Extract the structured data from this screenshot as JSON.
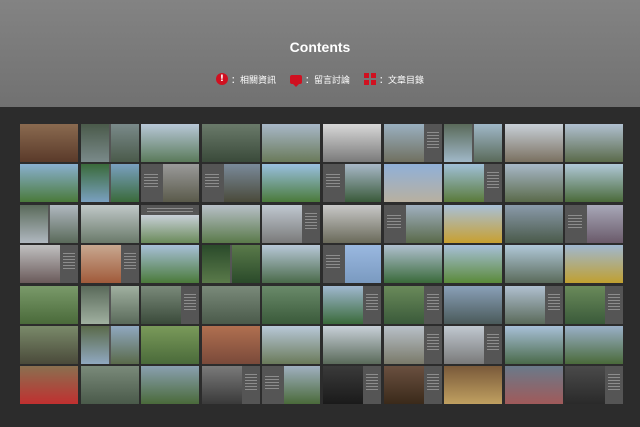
{
  "page": {
    "title": "Contents",
    "links": [
      {
        "icon": "info-icon",
        "label": "：相關資訊"
      },
      {
        "icon": "comment-icon",
        "label": "：留言討論"
      },
      {
        "icon": "grid-icon",
        "label": "：文章目錄"
      }
    ]
  },
  "colors": {
    "header": "#7a7a7a",
    "background": "#2c2c2c",
    "accent": "#d01020"
  },
  "thumbnails": [
    {
      "layout": "full",
      "colors": [
        "#8a6a50",
        "#5a3a2a"
      ]
    },
    {
      "layout": "split",
      "colors": [
        "#7a8a8a",
        "#4a5a4a"
      ]
    },
    {
      "layout": "full",
      "colors": [
        "#b8c8d8",
        "#5a7a5a"
      ]
    },
    {
      "layout": "full",
      "colors": [
        "#6a7a6a",
        "#3a4a3a"
      ]
    },
    {
      "layout": "full",
      "colors": [
        "#a8b8c8",
        "#6a7a5a"
      ]
    },
    {
      "layout": "full",
      "colors": [
        "#d8d8d8",
        "#7a7a7a"
      ]
    },
    {
      "layout": "text-right",
      "colors": [
        "#9ab0c0",
        "#707060"
      ]
    },
    {
      "layout": "split",
      "colors": [
        "#a0b8c8",
        "#5a6a5a"
      ]
    },
    {
      "layout": "full",
      "colors": [
        "#c8d0d8",
        "#7a7060"
      ]
    },
    {
      "layout": "full",
      "colors": [
        "#b0c0d0",
        "#5a6a4a"
      ]
    },
    {
      "layout": "full",
      "colors": [
        "#8ab0d0",
        "#4a7a3a"
      ]
    },
    {
      "layout": "split",
      "colors": [
        "#7aa0c0",
        "#3a6a3a"
      ]
    },
    {
      "layout": "text-left",
      "colors": [
        "#9a9a9a",
        "#5a5a4a"
      ]
    },
    {
      "layout": "text-left",
      "colors": [
        "#7a8a9a",
        "#4a4a3a"
      ]
    },
    {
      "layout": "full",
      "colors": [
        "#9ac0e0",
        "#4a7a3a"
      ]
    },
    {
      "layout": "text-left",
      "colors": [
        "#a8b8c8",
        "#3a5a3a"
      ]
    },
    {
      "layout": "full",
      "colors": [
        "#90b0d8",
        "#b8b0a0"
      ]
    },
    {
      "layout": "text-right",
      "colors": [
        "#a0c0d8",
        "#5a7a3a"
      ]
    },
    {
      "layout": "full",
      "colors": [
        "#a8b8c8",
        "#5a6a4a"
      ]
    },
    {
      "layout": "full",
      "colors": [
        "#b0c8d8",
        "#4a6a3a"
      ]
    },
    {
      "layout": "split",
      "colors": [
        "#b0b8c0",
        "#5a6a5a"
      ]
    },
    {
      "layout": "full",
      "colors": [
        "#c0c8c8",
        "#6a7a6a"
      ]
    },
    {
      "layout": "text-top",
      "colors": [
        "#c8d0d8",
        "#6a8a5a"
      ]
    },
    {
      "layout": "full",
      "colors": [
        "#b8c0c8",
        "#5a7a4a"
      ]
    },
    {
      "layout": "text-right",
      "colors": [
        "#c0c8d0",
        "#7a7a7a"
      ]
    },
    {
      "layout": "full",
      "colors": [
        "#c8c8c8",
        "#6a6a5a"
      ]
    },
    {
      "layout": "text-left",
      "colors": [
        "#a0b0c0",
        "#5a6a4a"
      ]
    },
    {
      "layout": "full",
      "colors": [
        "#a8c0d8",
        "#c8a030"
      ]
    },
    {
      "layout": "full",
      "colors": [
        "#8a9aaa",
        "#4a5a4a"
      ]
    },
    {
      "layout": "text-left",
      "colors": [
        "#a8a8b8",
        "#6a5a6a"
      ]
    },
    {
      "layout": "text-right",
      "colors": [
        "#c0c0c0",
        "#6a5a5a"
      ]
    },
    {
      "layout": "text-right",
      "colors": [
        "#c8a890",
        "#a05a3a"
      ]
    },
    {
      "layout": "full",
      "colors": [
        "#a8c0d8",
        "#4a7a3a"
      ]
    },
    {
      "layout": "split",
      "colors": [
        "#5a7a4a",
        "#2a4a2a"
      ]
    },
    {
      "layout": "full",
      "colors": [
        "#b8c8d8",
        "#4a6a4a"
      ]
    },
    {
      "layout": "text-left",
      "colors": [
        "#9ab8e0",
        "#7a9ac0"
      ]
    },
    {
      "layout": "full",
      "colors": [
        "#b0c0d0",
        "#3a6a3a"
      ]
    },
    {
      "layout": "full",
      "colors": [
        "#a8c0d8",
        "#5a8a3a"
      ]
    },
    {
      "layout": "full",
      "colors": [
        "#b0c8d8",
        "#5a6a5a"
      ]
    },
    {
      "layout": "full",
      "colors": [
        "#a0b8d0",
        "#c0a030"
      ]
    },
    {
      "layout": "full",
      "colors": [
        "#7a9a6a",
        "#4a6a3a"
      ]
    },
    {
      "layout": "split",
      "colors": [
        "#a0b0a0",
        "#5a6a5a"
      ]
    },
    {
      "layout": "text-right",
      "colors": [
        "#7a8a7a",
        "#3a4a3a"
      ]
    },
    {
      "layout": "full",
      "colors": [
        "#7a8a7a",
        "#4a5a4a"
      ]
    },
    {
      "layout": "full",
      "colors": [
        "#6a8a6a",
        "#3a5a3a"
      ]
    },
    {
      "layout": "text-right",
      "colors": [
        "#a0b8d0",
        "#3a6a3a"
      ]
    },
    {
      "layout": "text-right",
      "colors": [
        "#6a8a5a",
        "#3a5a3a"
      ]
    },
    {
      "layout": "full",
      "colors": [
        "#8aa0b8",
        "#4a5a5a"
      ]
    },
    {
      "layout": "text-right",
      "colors": [
        "#b0c0d0",
        "#5a6a5a"
      ]
    },
    {
      "layout": "text-right",
      "colors": [
        "#6a8a5a",
        "#3a5a3a"
      ]
    },
    {
      "layout": "full",
      "colors": [
        "#7a8a6a",
        "#4a4a3a"
      ]
    },
    {
      "layout": "split",
      "colors": [
        "#90a8c0",
        "#5a6a4a"
      ]
    },
    {
      "layout": "full",
      "colors": [
        "#7a9a5a",
        "#4a6a3a"
      ]
    },
    {
      "layout": "full",
      "colors": [
        "#b07050",
        "#7a4a3a"
      ]
    },
    {
      "layout": "full",
      "colors": [
        "#b8c8d8",
        "#6a7a5a"
      ]
    },
    {
      "layout": "full",
      "colors": [
        "#c8d0d8",
        "#5a6a5a"
      ]
    },
    {
      "layout": "text-right",
      "colors": [
        "#b8c0c8",
        "#7a7a6a"
      ]
    },
    {
      "layout": "text-right",
      "colors": [
        "#c0c8d0",
        "#7a7a7a"
      ]
    },
    {
      "layout": "full",
      "colors": [
        "#a8c0d8",
        "#4a6a4a"
      ]
    },
    {
      "layout": "full",
      "colors": [
        "#9ab0c8",
        "#4a6a3a"
      ]
    },
    {
      "layout": "full",
      "colors": [
        "#8a7050",
        "#c03030"
      ]
    },
    {
      "layout": "full",
      "colors": [
        "#7a8a7a",
        "#4a5a4a"
      ]
    },
    {
      "layout": "full",
      "colors": [
        "#8aa0b0",
        "#4a6a3a"
      ]
    },
    {
      "layout": "text-right",
      "colors": [
        "#7a7a7a",
        "#3a3a3a"
      ]
    },
    {
      "layout": "text-left",
      "colors": [
        "#a0b0c0",
        "#4a6a3a"
      ]
    },
    {
      "layout": "text-right",
      "colors": [
        "#3a3a3a",
        "#1a1a1a"
      ]
    },
    {
      "layout": "text-right",
      "colors": [
        "#6a5040",
        "#3a2a1a"
      ]
    },
    {
      "layout": "full",
      "colors": [
        "#7a5a3a",
        "#c0a060"
      ]
    },
    {
      "layout": "full",
      "colors": [
        "#6a7a8a",
        "#a05a5a"
      ]
    },
    {
      "layout": "text-right",
      "colors": [
        "#4a4a4a",
        "#2a2a2a"
      ]
    }
  ]
}
